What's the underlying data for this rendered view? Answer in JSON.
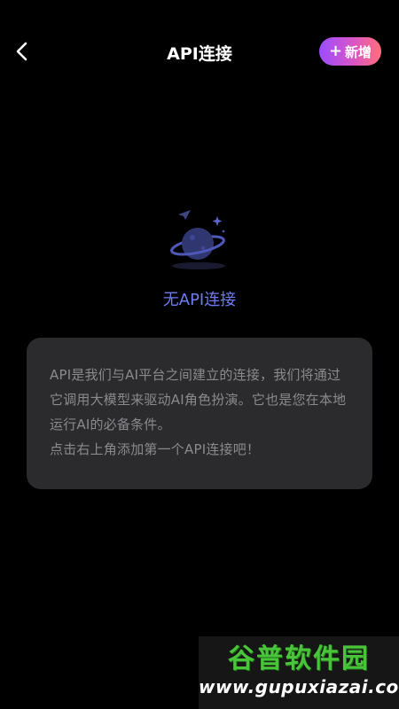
{
  "header": {
    "back_icon": "chevron-left-icon",
    "title": "API连接",
    "add_button_plus": "+",
    "add_button_label": "新增",
    "add_button_gradient": [
      "#9b4dff",
      "#d955c6",
      "#ff6f7a"
    ]
  },
  "empty_state": {
    "illustration_icon": "planet-icon",
    "title": "无API连接",
    "title_color": "#6d7cf0"
  },
  "info_card": {
    "lines": [
      "API是我们与AI平台之间建立的连接，我们将通过它调用大模型来驱动AI角色扮演。它也是您在本地运行AI的必备条件。",
      "点击右上角添加第一个API连接吧！"
    ]
  },
  "watermark": {
    "name": "谷普软件园",
    "url": "www.gupuxiazai.com"
  }
}
